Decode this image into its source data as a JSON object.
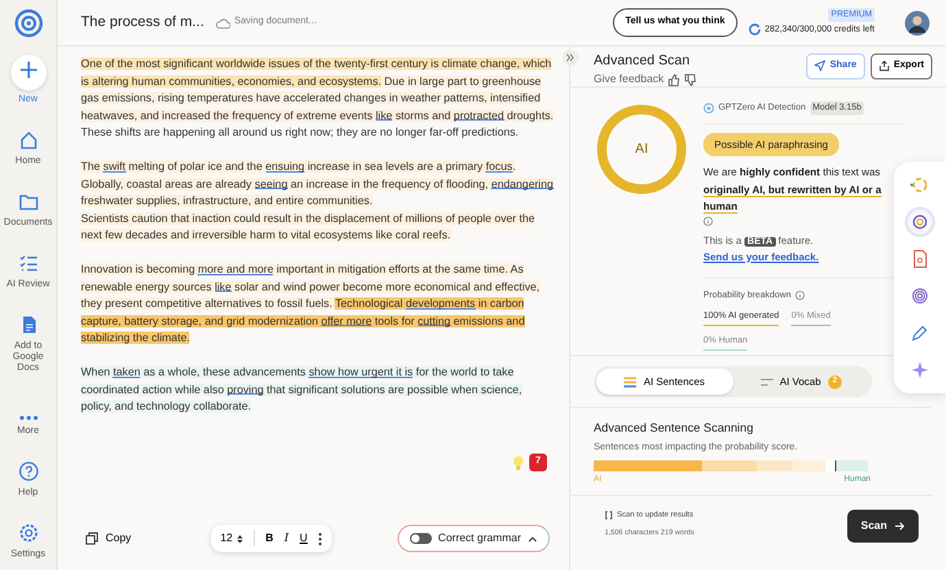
{
  "header": {
    "title": "The process of m...",
    "save_status": "Saving document...",
    "feedback_button": "Tell us what you think",
    "plan": "PREMIUM",
    "credits": "282,340/300,000 credits left"
  },
  "sidebar": {
    "items": [
      {
        "label": "New",
        "kind": "plus"
      },
      {
        "label": "Home",
        "kind": "home"
      },
      {
        "label": "Documents",
        "kind": "folder"
      },
      {
        "label": "AI Review",
        "kind": "checklist"
      },
      {
        "label": "Add to Google Docs",
        "kind": "doc"
      },
      {
        "label": "More",
        "kind": "dots"
      },
      {
        "label": "Help",
        "kind": "help"
      },
      {
        "label": "Settings",
        "kind": "gear"
      }
    ]
  },
  "editor": {
    "paragraphs": [
      [
        {
          "text": "One of the most significant worldwide issues of the twenty-first century is climate change, which is altering human communities, economies, and ecosystems.",
          "kind": "medium",
          "underlined": false
        },
        {
          "text": " Due in large part to greenhouse gas emissions, rising temperatures have accelerated changes in weather patterns, intensified heatwaves, and increased the frequency of extreme events ",
          "kind": "light",
          "underlined": false
        },
        {
          "text": "like",
          "kind": "light",
          "underlined": true
        },
        {
          "text": " storms and ",
          "kind": "light",
          "underlined": false
        },
        {
          "text": "protracted",
          "kind": "light",
          "underlined": true
        },
        {
          "text": " droughts.",
          "kind": "light",
          "underlined": false
        },
        {
          "text": " These shifts are happening all around us right now; they are no longer far-off predictions.",
          "kind": "none",
          "underlined": false
        }
      ],
      [
        {
          "text": "The ",
          "kind": "light",
          "underlined": false
        },
        {
          "text": "swift",
          "kind": "light",
          "underlined": true
        },
        {
          "text": " melting of polar ice and the ",
          "kind": "light",
          "underlined": false
        },
        {
          "text": "ensuing",
          "kind": "light",
          "underlined": true
        },
        {
          "text": " increase in sea levels are a primary ",
          "kind": "light",
          "underlined": false
        },
        {
          "text": "focus",
          "kind": "light",
          "underlined": true
        },
        {
          "text": ". Globally, coastal areas are already ",
          "kind": "light",
          "underlined": false
        },
        {
          "text": "seeing",
          "kind": "light",
          "underlined": true
        },
        {
          "text": " an increase in the frequency of flooding, ",
          "kind": "light",
          "underlined": false
        },
        {
          "text": "endangering",
          "kind": "light",
          "underlined": true
        },
        {
          "text": " freshwater supplies, infrastructure, and entire communities.\nScientists caution that inaction could result in the displacement of millions of people over the next few decades and irreversible harm to vital ecosystems like coral reefs.",
          "kind": "light",
          "underlined": false
        }
      ],
      [
        {
          "text": "Innovation is becoming ",
          "kind": "light",
          "underlined": false
        },
        {
          "text": "more and more",
          "kind": "light",
          "underlined": true
        },
        {
          "text": " important in mitigation efforts at the same time. As renewable energy sources ",
          "kind": "light",
          "underlined": false
        },
        {
          "text": "like",
          "kind": "light",
          "underlined": true
        },
        {
          "text": " solar and wind power become more economical and effective, they present competitive alternatives to fossil fuels. ",
          "kind": "light",
          "underlined": false
        },
        {
          "text": "Technological ",
          "kind": "strong",
          "underlined": false
        },
        {
          "text": "developments",
          "kind": "strong",
          "underlined": true
        },
        {
          "text": " in carbon capture, battery storage, and grid modernization ",
          "kind": "strong",
          "underlined": false
        },
        {
          "text": "offer more",
          "kind": "strong",
          "underlined": true
        },
        {
          "text": " tools for ",
          "kind": "strong",
          "underlined": false
        },
        {
          "text": "cutting",
          "kind": "strong",
          "underlined": true
        },
        {
          "text": " emissions and stabilizing the climate.",
          "kind": "strong",
          "underlined": false
        }
      ],
      [
        {
          "text": "When ",
          "kind": "human",
          "underlined": false
        },
        {
          "text": "taken",
          "kind": "human",
          "underlined": true
        },
        {
          "text": " as a whole, these advancements ",
          "kind": "human",
          "underlined": false
        },
        {
          "text": "show how urgent it is",
          "kind": "human",
          "underlined": true
        },
        {
          "text": " for the world to take coordinated action while also ",
          "kind": "human",
          "underlined": false
        },
        {
          "text": "proving",
          "kind": "human",
          "underlined": true
        },
        {
          "text": " that significant solutions are possible when science, policy, and technology collaborate.",
          "kind": "human",
          "underlined": false
        }
      ]
    ],
    "notification_count": "7"
  },
  "toolbar": {
    "copy": "Copy",
    "font_size": "12",
    "bold": "B",
    "italic": "I",
    "underline": "U",
    "grammar": {
      "label": "Correct grammar",
      "on": false
    }
  },
  "scan_panel": {
    "title": "Advanced Scan",
    "give_feedback": "Give feedback",
    "share": "Share",
    "export": "Export",
    "result": {
      "ring_label": "AI",
      "detector": "GPTZero AI Detection",
      "model": "Model 3.15b",
      "verdict": "Possible AI paraphrasing",
      "summary": "We are **highly confident** this text was **originally AI, but rewritten by AI or a human**",
      "beta": {
        "before": "This is a",
        "badge": "BETA",
        "after": "feature.",
        "link": "Send us your feedback."
      },
      "breakdown_title": "Probability breakdown",
      "breakdown": [
        {
          "label": "100% AI generated",
          "color": "#e8b82e"
        },
        {
          "label": "0% Mixed",
          "color": "#b7b0dc"
        },
        {
          "label": "0% Human",
          "color": "#a9d8c5"
        }
      ]
    },
    "tabs": [
      {
        "label": "AI Sentences",
        "selected": true
      },
      {
        "label": "AI Vocab",
        "selected": false,
        "badge": "2"
      }
    ],
    "section": {
      "title": "Advanced Sentence Scanning",
      "subtitle": "Sentences most impacting the probability score.",
      "segments": [
        {
          "color": "#f7b64a"
        },
        {
          "color": "#fbdca6"
        },
        {
          "color": "#fce8c8"
        },
        {
          "color": "#fdefd9"
        },
        {
          "color": "#ffffff"
        },
        {
          "color": "#dcf0e7"
        }
      ],
      "ai_label": "AI",
      "human_label": "Human"
    },
    "footer": {
      "hint": "Scan to update results",
      "counts": "1,506 characters 219 words",
      "scan_button": "Scan"
    }
  },
  "rail": [
    {
      "kind": "spinner",
      "selected": false
    },
    {
      "kind": "target",
      "selected": true
    },
    {
      "kind": "file",
      "selected": false
    },
    {
      "kind": "fingerprint",
      "selected": false
    },
    {
      "kind": "pen",
      "selected": false
    },
    {
      "kind": "sparkle",
      "selected": false
    }
  ]
}
